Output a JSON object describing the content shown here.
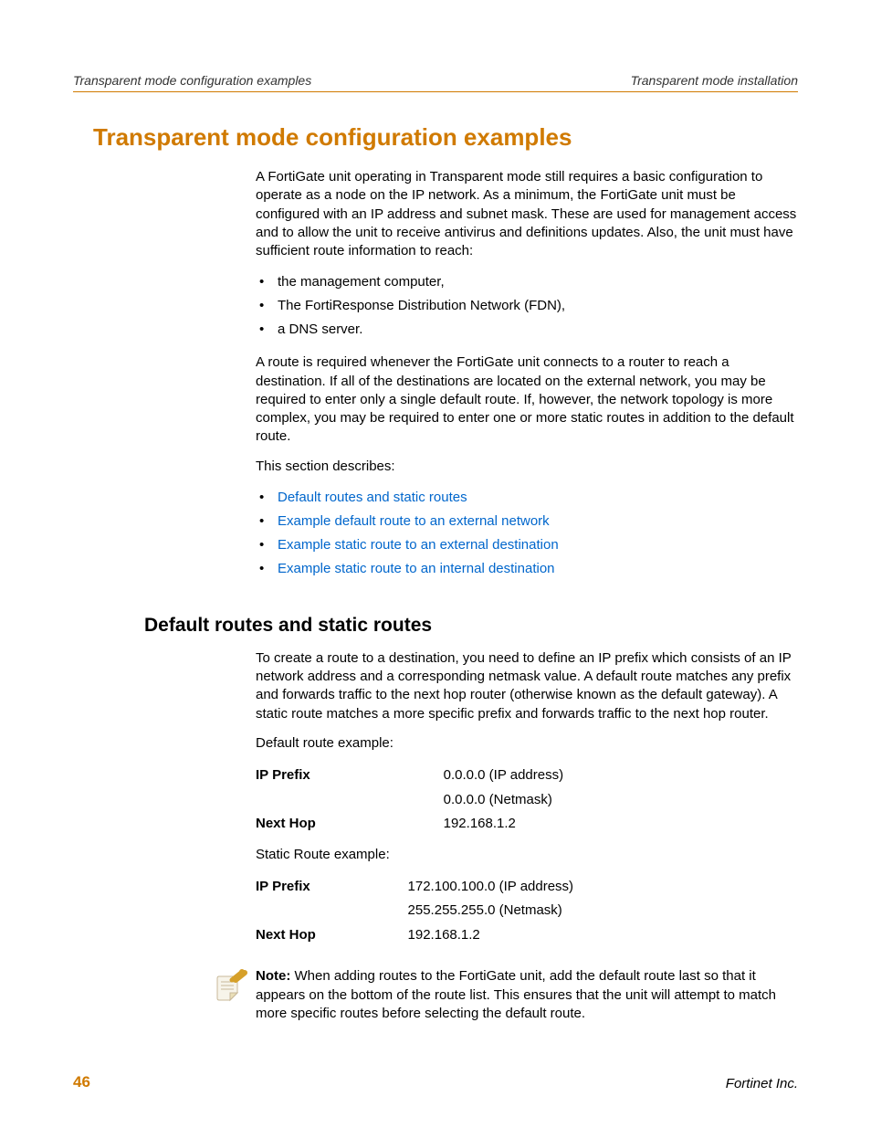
{
  "header": {
    "left": "Transparent mode configuration examples",
    "right": "Transparent mode installation"
  },
  "h1": "Transparent mode configuration examples",
  "intro_p1": "A FortiGate unit operating in Transparent mode still requires a basic configuration to operate as a node on the IP network. As a minimum, the FortiGate unit must be configured with an IP address and subnet mask. These are used for management access and to allow the unit to receive antivirus and definitions updates. Also, the unit must have sufficient route information to reach:",
  "intro_bullets": [
    "the management computer,",
    "The FortiResponse Distribution Network (FDN),",
    "a DNS server."
  ],
  "intro_p2": "A route is required whenever the FortiGate unit connects to a router to reach a destination. If all of the destinations are located on the external network, you may be required to enter only a single default route. If, however, the network topology is more complex, you may be required to enter one or more static routes in addition to the default route.",
  "intro_p3": "This section describes:",
  "section_links": [
    "Default routes and static routes",
    "Example default route to an external network",
    "Example static route to an external destination",
    "Example static route to an internal destination"
  ],
  "h2": "Default routes and static routes",
  "routes_p1": "To create a route to a destination, you need to define an IP prefix which consists of an IP network address and a corresponding netmask value. A default route matches any prefix and forwards traffic to the next hop router (otherwise known as the default gateway). A static route matches a more specific prefix and forwards traffic to the next hop router.",
  "default_example_heading": "Default route example:",
  "labels": {
    "ip_prefix": "IP Prefix",
    "next_hop": "Next Hop"
  },
  "default_example": {
    "ip_address": "0.0.0.0 (IP address)",
    "netmask": "0.0.0.0 (Netmask)",
    "next_hop": "192.168.1.2"
  },
  "static_example_heading": "Static Route example:",
  "static_example": {
    "ip_address": "172.100.100.0 (IP address)",
    "netmask": "255.255.255.0 (Netmask)",
    "next_hop": "192.168.1.2"
  },
  "note_label": "Note:",
  "note_body": " When adding routes to the FortiGate unit, add the default route last so that it appears on the bottom of the route list. This ensures that the unit will attempt to match more specific routes before selecting the default route.",
  "footer": {
    "page_number": "46",
    "company": "Fortinet Inc."
  }
}
